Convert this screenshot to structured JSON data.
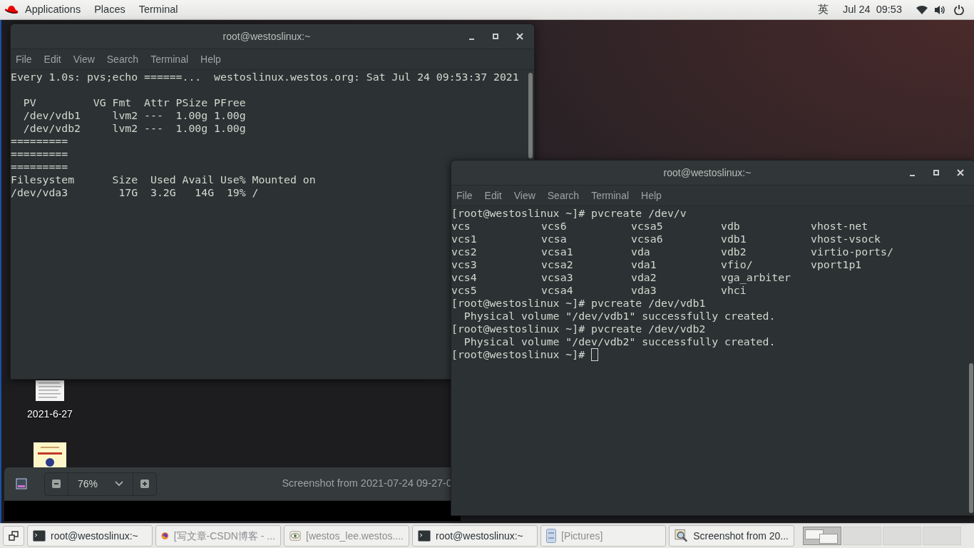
{
  "top_bar": {
    "menus": [
      "Applications",
      "Places",
      "Terminal"
    ],
    "input_method": "英",
    "clock": "Jul 24  09:53"
  },
  "desktop_icons": [
    {
      "label": "2021-6-27"
    }
  ],
  "image_viewer": {
    "zoom": "76%",
    "title": "Screenshot from 2021-07-24 09-27-0"
  },
  "watch_terminal": {
    "title": "root@westoslinux:~",
    "menu": [
      "File",
      "Edit",
      "View",
      "Search",
      "Terminal",
      "Help"
    ],
    "header": "Every 1.0s: pvs;echo ======...  westoslinux.westos.org: Sat Jul 24 09:53:37 2021",
    "lines": [
      "  PV         VG Fmt  Attr PSize PFree",
      "  /dev/vdb1     lvm2 ---  1.00g 1.00g",
      "  /dev/vdb2     lvm2 ---  1.00g 1.00g",
      "=========",
      "=========",
      "=========",
      "Filesystem      Size  Used Avail Use% Mounted on",
      "/dev/vda3        17G  3.2G   14G  19% /"
    ]
  },
  "shell_terminal": {
    "title": "root@westoslinux:~",
    "menu": [
      "File",
      "Edit",
      "View",
      "Search",
      "Terminal",
      "Help"
    ],
    "command": "[root@westoslinux ~]# pvcreate /dev/v",
    "completions": [
      [
        "vcs",
        "vcs6",
        "vcsa5",
        "vdb",
        "vhost-net"
      ],
      [
        "vcs1",
        "vcsa",
        "vcsa6",
        "vdb1",
        "vhost-vsock"
      ],
      [
        "vcs2",
        "vcsa1",
        "vda",
        "vdb2",
        "virtio-ports/"
      ],
      [
        "vcs3",
        "vcsa2",
        "vda1",
        "vfio/",
        "vport1p1"
      ],
      [
        "vcs4",
        "vcsa3",
        "vda2",
        "vga_arbiter"
      ],
      [
        "vcs5",
        "vcsa4",
        "vda3",
        "vhci"
      ]
    ],
    "lines": [
      "[root@westoslinux ~]# pvcreate /dev/vdb1",
      "  Physical volume \"/dev/vdb1\" successfully created.",
      "[root@westoslinux ~]# pvcreate /dev/vdb2",
      "  Physical volume \"/dev/vdb2\" successfully created."
    ],
    "prompt": "[root@westoslinux ~]#"
  },
  "taskbar": {
    "windows": [
      {
        "label": "root@westoslinux:~",
        "kind": "terminal",
        "minimized": false
      },
      {
        "label": "[写文章-CSDN博客 - ...",
        "kind": "browser",
        "minimized": true
      },
      {
        "label": "[westos_lee.westos....",
        "kind": "viewer",
        "minimized": true
      },
      {
        "label": "root@westoslinux:~",
        "kind": "terminal",
        "minimized": false
      },
      {
        "label": "[Pictures]",
        "kind": "files",
        "minimized": true
      },
      {
        "label": "Screenshot from 20...",
        "minimized": false
      }
    ],
    "workspaces": [
      {
        "selected": true
      },
      {
        "selected": false
      },
      {
        "selected": false
      },
      {
        "selected": false
      }
    ]
  }
}
